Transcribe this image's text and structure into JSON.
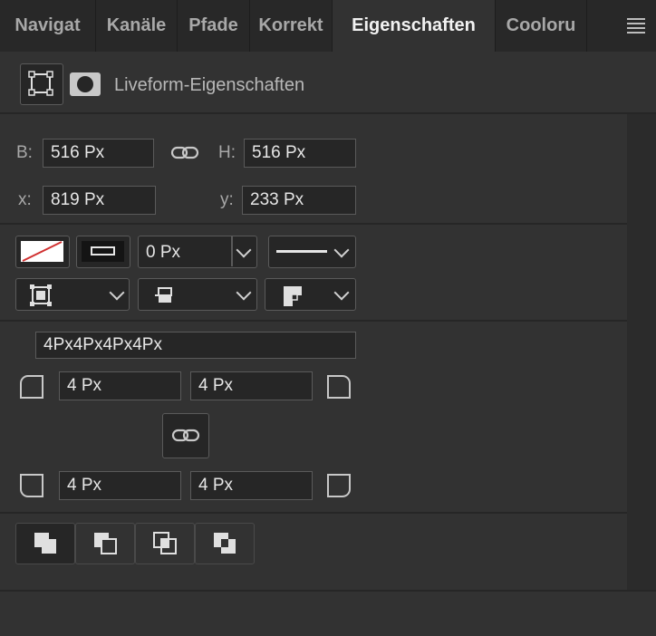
{
  "tabs": [
    {
      "label": "Navigat"
    },
    {
      "label": "Kanäle"
    },
    {
      "label": "Pfade"
    },
    {
      "label": "Korrekt"
    },
    {
      "label": "Eigenschaften"
    },
    {
      "label": "Cooloru"
    }
  ],
  "panel": {
    "title": "Liveform-Eigenschaften"
  },
  "transform": {
    "w_label": "B:",
    "w_value": "516 Px",
    "h_label": "H:",
    "h_value": "516 Px",
    "x_label": "x:",
    "x_value": "819 Px",
    "y_label": "y:",
    "y_value": "233 Px"
  },
  "stroke": {
    "width_value": "0 Px"
  },
  "corners": {
    "summary": "4Px4Px4Px4Px",
    "top_left": "4 Px",
    "top_right": "4 Px",
    "bottom_left": "4 Px",
    "bottom_right": "4 Px"
  },
  "icons": {
    "shape": "bounding-box-icon",
    "mask": "mask-icon",
    "link": "link-icon",
    "fill": "no-fill-icon",
    "stroke": "stroke-color-icon"
  }
}
